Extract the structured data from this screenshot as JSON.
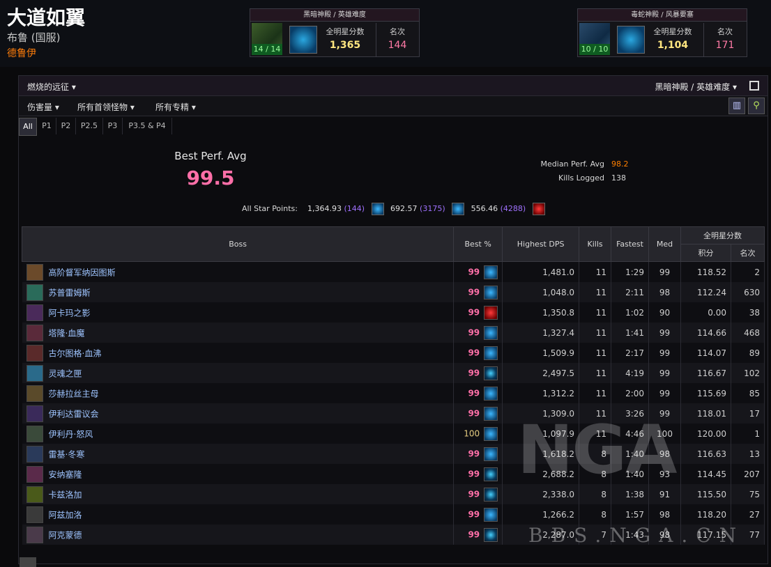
{
  "character": {
    "name": "大道如翼",
    "realm": "布鲁 (国服)",
    "class": "德鲁伊"
  },
  "rank_cards": [
    {
      "title": "黑暗神殿 / 英雄难度",
      "progress": "14 / 14",
      "score_label": "全明星分数",
      "score": "1,365",
      "rank_label": "名次",
      "rank": "144"
    },
    {
      "title": "毒蛇神殿 / 风暴要塞",
      "progress": "10 / 10",
      "score_label": "全明星分数",
      "score": "1,104",
      "rank_label": "名次",
      "rank": "171"
    }
  ],
  "panel": {
    "zone": "燃烧的远征",
    "difficulty": "黑暗神殿 / 英雄难度",
    "filters": [
      "伤害量",
      "所有首领怪物",
      "所有专精"
    ],
    "tabs": [
      "All",
      "P1",
      "P2",
      "P2.5",
      "P3",
      "P3.5 & P4"
    ],
    "summary": {
      "best_label": "Best Perf. Avg",
      "best_value": "99.5",
      "median_label": "Median Perf. Avg",
      "median_value": "98.2",
      "kills_label": "Kills Logged",
      "kills_value": "138",
      "allstar_label": "All Star Points:",
      "allstar": [
        {
          "points": "1,364.93",
          "rank": "(144)",
          "spec": "frost"
        },
        {
          "points": "692.57",
          "rank": "(3175)",
          "spec": "frost"
        },
        {
          "points": "556.46",
          "rank": "(4288)",
          "spec": "blood"
        }
      ]
    }
  },
  "table": {
    "headers": {
      "boss": "Boss",
      "best": "Best %",
      "dps": "Highest DPS",
      "kills": "Kills",
      "fastest": "Fastest",
      "med": "Med",
      "allstar": "全明星分数",
      "points": "积分",
      "rank": "名次"
    },
    "rows": [
      {
        "boss": "高阶督军纳因图斯",
        "best": "99",
        "spec": "frost",
        "dps": "1,481.0",
        "kills": "11",
        "fastest": "1:29",
        "med": "99",
        "points": "118.52",
        "rank": "2",
        "icon_color": "#6b4a2a"
      },
      {
        "boss": "苏普雷姆斯",
        "best": "99",
        "spec": "frost",
        "dps": "1,048.0",
        "kills": "11",
        "fastest": "2:11",
        "med": "98",
        "points": "112.24",
        "rank": "630",
        "icon_color": "#2a6b5a"
      },
      {
        "boss": "阿卡玛之影",
        "best": "99",
        "spec": "blood",
        "dps": "1,350.8",
        "kills": "11",
        "fastest": "1:02",
        "med": "90",
        "points": "0.00",
        "rank": "38",
        "icon_color": "#4a2a5a"
      },
      {
        "boss": "塔隆·血魔",
        "best": "99",
        "spec": "frost",
        "dps": "1,327.4",
        "kills": "11",
        "fastest": "1:41",
        "med": "99",
        "points": "114.66",
        "rank": "468",
        "icon_color": "#5a2a3a"
      },
      {
        "boss": "古尔图格·血沸",
        "best": "99",
        "spec": "frost",
        "dps": "1,509.9",
        "kills": "11",
        "fastest": "2:17",
        "med": "99",
        "points": "114.07",
        "rank": "89",
        "icon_color": "#5a2a2a"
      },
      {
        "boss": "灵魂之匣",
        "best": "99",
        "spec": "unholy",
        "dps": "2,497.5",
        "kills": "11",
        "fastest": "4:19",
        "med": "99",
        "points": "116.67",
        "rank": "102",
        "icon_color": "#2a6a8a"
      },
      {
        "boss": "莎赫拉丝主母",
        "best": "99",
        "spec": "frost",
        "dps": "1,312.2",
        "kills": "11",
        "fastest": "2:00",
        "med": "99",
        "points": "115.69",
        "rank": "85",
        "icon_color": "#5a4a2a"
      },
      {
        "boss": "伊利达雷议会",
        "best": "99",
        "spec": "frost",
        "dps": "1,309.0",
        "kills": "11",
        "fastest": "3:26",
        "med": "99",
        "points": "118.01",
        "rank": "17",
        "icon_color": "#3a2a5a"
      },
      {
        "boss": "伊利丹·怒风",
        "best": "100",
        "spec": "frost",
        "dps": "1,097.9",
        "kills": "11",
        "fastest": "4:46",
        "med": "100",
        "points": "120.00",
        "rank": "1",
        "icon_color": "#3a4a3a"
      },
      {
        "boss": "雷基·冬寒",
        "best": "99",
        "spec": "frost",
        "dps": "1,618.2",
        "kills": "8",
        "fastest": "1:40",
        "med": "98",
        "points": "116.63",
        "rank": "13",
        "icon_color": "#2a3a5a"
      },
      {
        "boss": "安纳塞隆",
        "best": "99",
        "spec": "unholy",
        "dps": "2,688.2",
        "kills": "8",
        "fastest": "1:40",
        "med": "93",
        "points": "114.45",
        "rank": "207",
        "icon_color": "#5a2a4a"
      },
      {
        "boss": "卡兹洛加",
        "best": "99",
        "spec": "unholy",
        "dps": "2,338.0",
        "kills": "8",
        "fastest": "1:38",
        "med": "91",
        "points": "115.50",
        "rank": "75",
        "icon_color": "#4a5a1a"
      },
      {
        "boss": "阿兹加洛",
        "best": "99",
        "spec": "frost",
        "dps": "1,266.2",
        "kills": "8",
        "fastest": "1:57",
        "med": "98",
        "points": "118.20",
        "rank": "27",
        "icon_color": "#3a3a3a"
      },
      {
        "boss": "阿克蒙德",
        "best": "99",
        "spec": "unholy",
        "dps": "2,287.0",
        "kills": "7",
        "fastest": "1:43",
        "med": "98",
        "points": "117.15",
        "rank": "77",
        "icon_color": "#4a3a4a"
      }
    ]
  },
  "watermark": {
    "logo": "NGA",
    "site": "BBS.NGA.CN"
  },
  "colors": {
    "pink": "#ff6fa8",
    "orange": "#ff8000",
    "purple": "#a335ee",
    "gold": "#e5cc80",
    "link": "#9ec4ff"
  }
}
